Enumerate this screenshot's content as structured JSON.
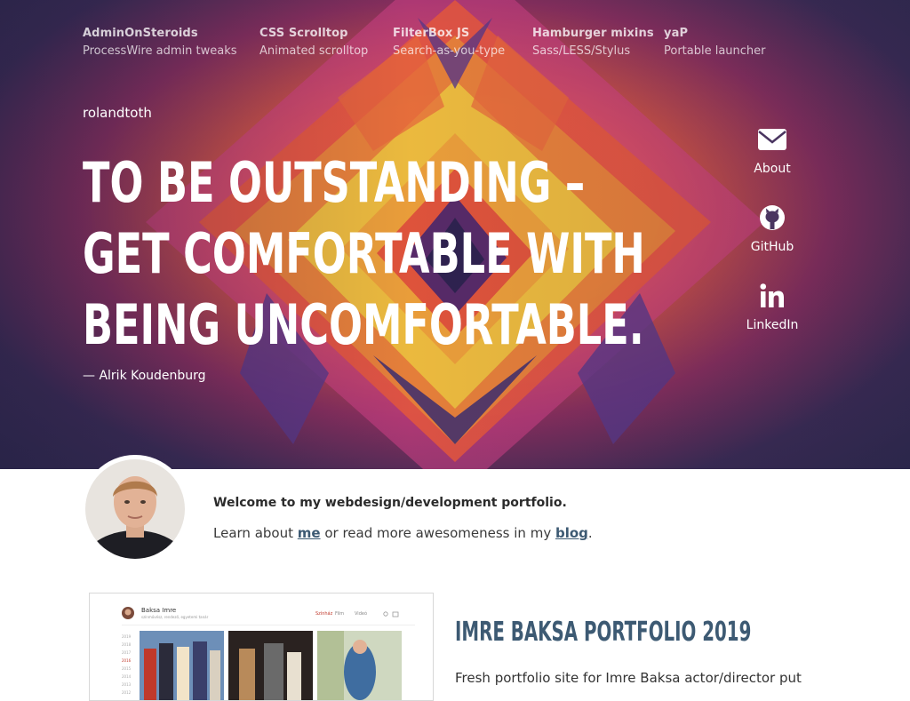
{
  "top_links": [
    {
      "title": "AdminOnSteroids",
      "subtitle": "ProcessWire admin tweaks"
    },
    {
      "title": "CSS Scrolltop",
      "subtitle": "Animated scrolltop"
    },
    {
      "title": "FilterBox JS",
      "subtitle": "Search-as-you-type"
    },
    {
      "title": "Hamburger mixins",
      "subtitle": "Sass/LESS/Stylus"
    },
    {
      "title": "yaP",
      "subtitle": "Portable launcher"
    }
  ],
  "brand": "rolandtoth",
  "hero": {
    "quote": "To be outstanding – get comfortable with being uncomfortable.",
    "author": "— Alrik Koudenburg"
  },
  "side_nav": [
    {
      "label": "About",
      "icon": "envelope-icon"
    },
    {
      "label": "GitHub",
      "icon": "github-icon"
    },
    {
      "label": "LinkedIn",
      "icon": "linkedin-icon"
    }
  ],
  "intro": {
    "welcome": "Welcome to my webdesign/development portfolio.",
    "learn_prefix": "Learn about ",
    "me_link": "me",
    "learn_middle": " or read more awesomeness in my ",
    "blog_link": "blog",
    "learn_suffix": "."
  },
  "project": {
    "title": "Imre Baksa Portfolio 2019",
    "description": "Fresh portfolio site for Imre Baksa actor/director put",
    "preview": {
      "name": "Baksa Imre",
      "subtitle": "színművész, rendező, egyetemi tanár",
      "nav": [
        "Színház",
        "Film",
        "Videó"
      ],
      "years": [
        "2019",
        "2018",
        "2017",
        "2016",
        "2015",
        "2014",
        "2013",
        "2012"
      ]
    }
  },
  "colors": {
    "accent": "#3d5a73",
    "hero_dark": "#2e2a4e",
    "hero_orange": "#e9603e",
    "hero_yellow": "#f4c542"
  }
}
